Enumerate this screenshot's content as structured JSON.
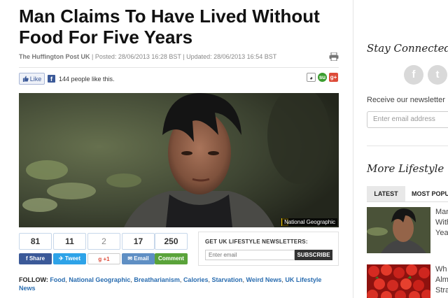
{
  "article": {
    "headline": "Man Claims To Have Lived Without Food For Five Years",
    "byline": {
      "source": "The Huffington Post UK",
      "sep": " | ",
      "posted": "Posted: 28/06/2013 16:28 BST",
      "updated": "Updated: 28/06/2013 16:54 BST"
    },
    "like": {
      "button_label": "Like",
      "count_text": "144 people like this."
    },
    "photo": {
      "credit": "National Geographic"
    },
    "share": [
      {
        "count": "81",
        "label": "Share",
        "color": "#3b5998",
        "icon": "facebook-icon"
      },
      {
        "count": "11",
        "label": "Tweet",
        "color": "#2ea3e8",
        "icon": "twitter-icon"
      },
      {
        "count": "2",
        "label": "+1",
        "color": "#ffffff",
        "icon": "google-plus-icon"
      },
      {
        "count": "17",
        "label": "Email",
        "color": "#5f8fc4",
        "icon": "email-icon"
      },
      {
        "count": "250",
        "label": "Comment",
        "color": "#5aa33a",
        "icon": "comment-icon"
      }
    ],
    "newsletter": {
      "title": "GET UK LIFESTYLE NEWSLETTERS:",
      "placeholder": "Enter email",
      "subscribe": "SUBSCRIBE"
    },
    "follow": {
      "label": "FOLLOW:",
      "tags": [
        "Food",
        "National Geographic",
        "Breatharianism",
        "Calories",
        "Starvation",
        "Weird News",
        "UK Lifestyle News"
      ]
    }
  },
  "sidebar": {
    "stay_connected": "Stay Connected",
    "social": [
      {
        "glyph": "f",
        "icon": "facebook-icon"
      },
      {
        "glyph": "t",
        "icon": "twitter-icon"
      }
    ],
    "receive_text": "Receive our newsletter",
    "email_placeholder": "Enter email address",
    "more_title": "More Lifestyle",
    "tabs": {
      "latest": "LATEST",
      "popular": "MOST POPU"
    },
    "items": [
      {
        "lines": [
          "Man",
          "With",
          "Yea"
        ]
      },
      {
        "lines": [
          "Wh",
          "Alm",
          "Stra"
        ]
      }
    ]
  },
  "colors": {
    "link": "#2a6db0",
    "facebook": "#3b5998",
    "twitter": "#2ea3e8",
    "google": "#dd4b39",
    "comment": "#5aa33a"
  }
}
